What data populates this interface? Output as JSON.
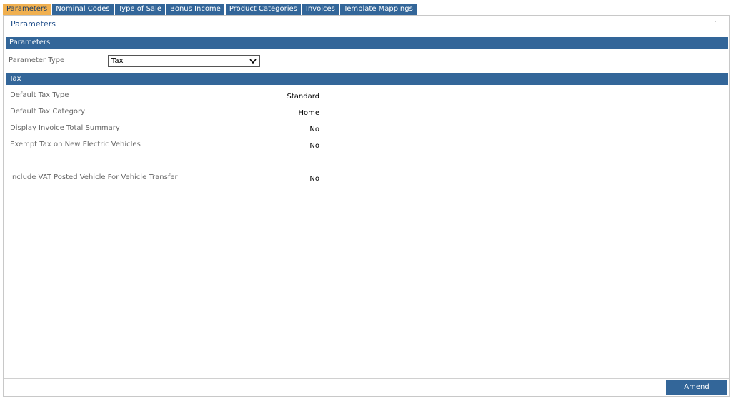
{
  "tabs": [
    {
      "label": "Parameters",
      "active": true
    },
    {
      "label": "Nominal Codes"
    },
    {
      "label": "Type of Sale"
    },
    {
      "label": "Bonus Income"
    },
    {
      "label": "Product Categories"
    },
    {
      "label": "Invoices"
    },
    {
      "label": "Template Mappings"
    }
  ],
  "page": {
    "title": "Parameters"
  },
  "parameters_section": {
    "header": "Parameters",
    "parameter_type_label": "Parameter Type",
    "parameter_type_value": "Tax"
  },
  "tax_section": {
    "header": "Tax",
    "fields": [
      {
        "label": "Default Tax Type",
        "value": "Standard"
      },
      {
        "label": "Default Tax Category",
        "value": "Home"
      },
      {
        "label": "Display Invoice Total Summary",
        "value": "No"
      },
      {
        "label": "Exempt Tax on New Electric Vehicles",
        "value": "No"
      },
      {
        "label": "Include VAT Posted Vehicle For Vehicle Transfer",
        "value": "No"
      }
    ]
  },
  "footer": {
    "amend_first": "A",
    "amend_rest": "mend"
  }
}
